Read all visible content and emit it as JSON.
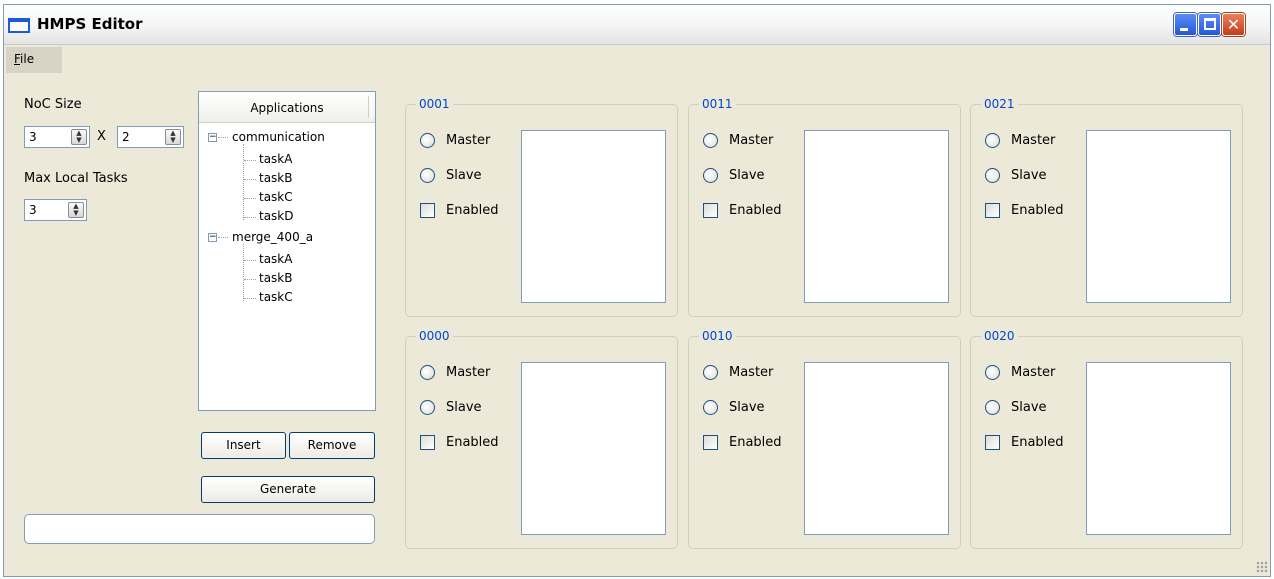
{
  "window": {
    "title": "HMPS Editor"
  },
  "titlebar_buttons": {
    "minimize_icon": "minimize-icon",
    "maximize_icon": "maximize-icon",
    "close_icon": "close-icon",
    "close_glyph": "✕"
  },
  "menu": {
    "file_accel": "F",
    "file_rest": "ile"
  },
  "left_panel": {
    "noc_size_label": "NoC Size",
    "noc_x": "3",
    "times_label": "X",
    "noc_y": "2",
    "max_local_tasks_label": "Max Local Tasks",
    "max_local_tasks": "3",
    "status_text": ""
  },
  "tree": {
    "header": "Applications",
    "applications": [
      {
        "name": "communication",
        "tasks": [
          "taskA",
          "taskB",
          "taskC",
          "taskD"
        ]
      },
      {
        "name": "merge_400_a",
        "tasks": [
          "taskA",
          "taskB",
          "taskC"
        ]
      }
    ]
  },
  "buttons": {
    "insert": "Insert",
    "remove": "Remove",
    "generate": "Generate"
  },
  "node_options": {
    "master": "Master",
    "slave": "Slave",
    "enabled": "Enabled"
  },
  "nodes": [
    {
      "id": "0001",
      "master": false,
      "slave": false,
      "enabled": false
    },
    {
      "id": "0011",
      "master": false,
      "slave": false,
      "enabled": false
    },
    {
      "id": "0021",
      "master": false,
      "slave": false,
      "enabled": false
    },
    {
      "id": "0000",
      "master": false,
      "slave": false,
      "enabled": false
    },
    {
      "id": "0010",
      "master": false,
      "slave": false,
      "enabled": false
    },
    {
      "id": "0020",
      "master": false,
      "slave": false,
      "enabled": false
    }
  ]
}
